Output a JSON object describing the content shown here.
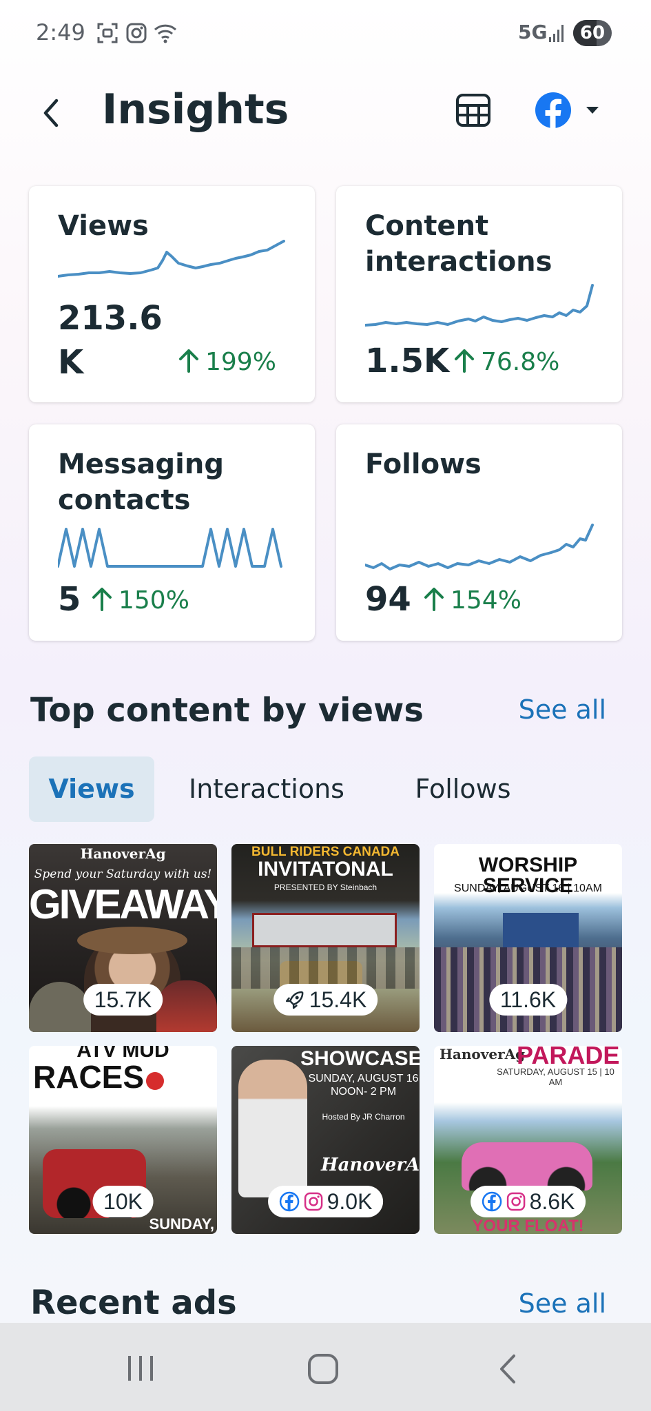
{
  "status_bar": {
    "time": "2:49",
    "network": "5G",
    "battery": "60"
  },
  "header": {
    "title": "Insights"
  },
  "metrics": [
    {
      "title": "Views",
      "value": "213.6\nK",
      "change": "199%"
    },
    {
      "title": "Content\ninteractions",
      "value": "1.5K",
      "change": "76.8%"
    },
    {
      "title": "Messaging\ncontacts",
      "value": "5",
      "change": "150%"
    },
    {
      "title": "Follows",
      "value": "94",
      "change": "154%"
    }
  ],
  "top_content": {
    "title": "Top content by views",
    "see_all": "See all",
    "tabs": [
      {
        "label": "Views",
        "active": true
      },
      {
        "label": "Interactions",
        "active": false
      },
      {
        "label": "Follows",
        "active": false
      }
    ],
    "items": [
      {
        "headline": "GIVEAWAY",
        "brand": "HanoverAg",
        "sub": "Spend your Saturday with us!",
        "count": "15.7K"
      },
      {
        "headline": "INVITATONAL",
        "brand": "BULL RIDERS CANADA",
        "sub": "PRESENTED BY Steinbach",
        "count": "15.4K"
      },
      {
        "headline": "WORSHIP SERVICE",
        "brand": "",
        "sub": "SUNDAY, AUGUST 16 | 10AM",
        "count": "11.6K"
      },
      {
        "headline": "RACES",
        "brand": "ATV MUD",
        "sub": "SUNDAY,",
        "count": "10K"
      },
      {
        "headline": "SHOWCASE",
        "brand": "HanoverAg",
        "sub": "SUNDAY, AUGUST 16\nNOON- 2 PM",
        "extra": "Hosted By JR Charron",
        "count": "9.0K"
      },
      {
        "headline": "PARADE",
        "brand": "HanoverAg",
        "sub": "SATURDAY, AUGUST 15 | 10 AM",
        "extra": "YOUR FLOAT!",
        "count": "8.6K"
      }
    ]
  },
  "recent_ads": {
    "title": "Recent ads",
    "see_all": "See all"
  },
  "colors": {
    "accent": "#1b72b8",
    "positive": "#1a7f4b",
    "sparkline": "#4a8fc4",
    "text": "#1c2b33",
    "facebook": "#1877f2"
  }
}
